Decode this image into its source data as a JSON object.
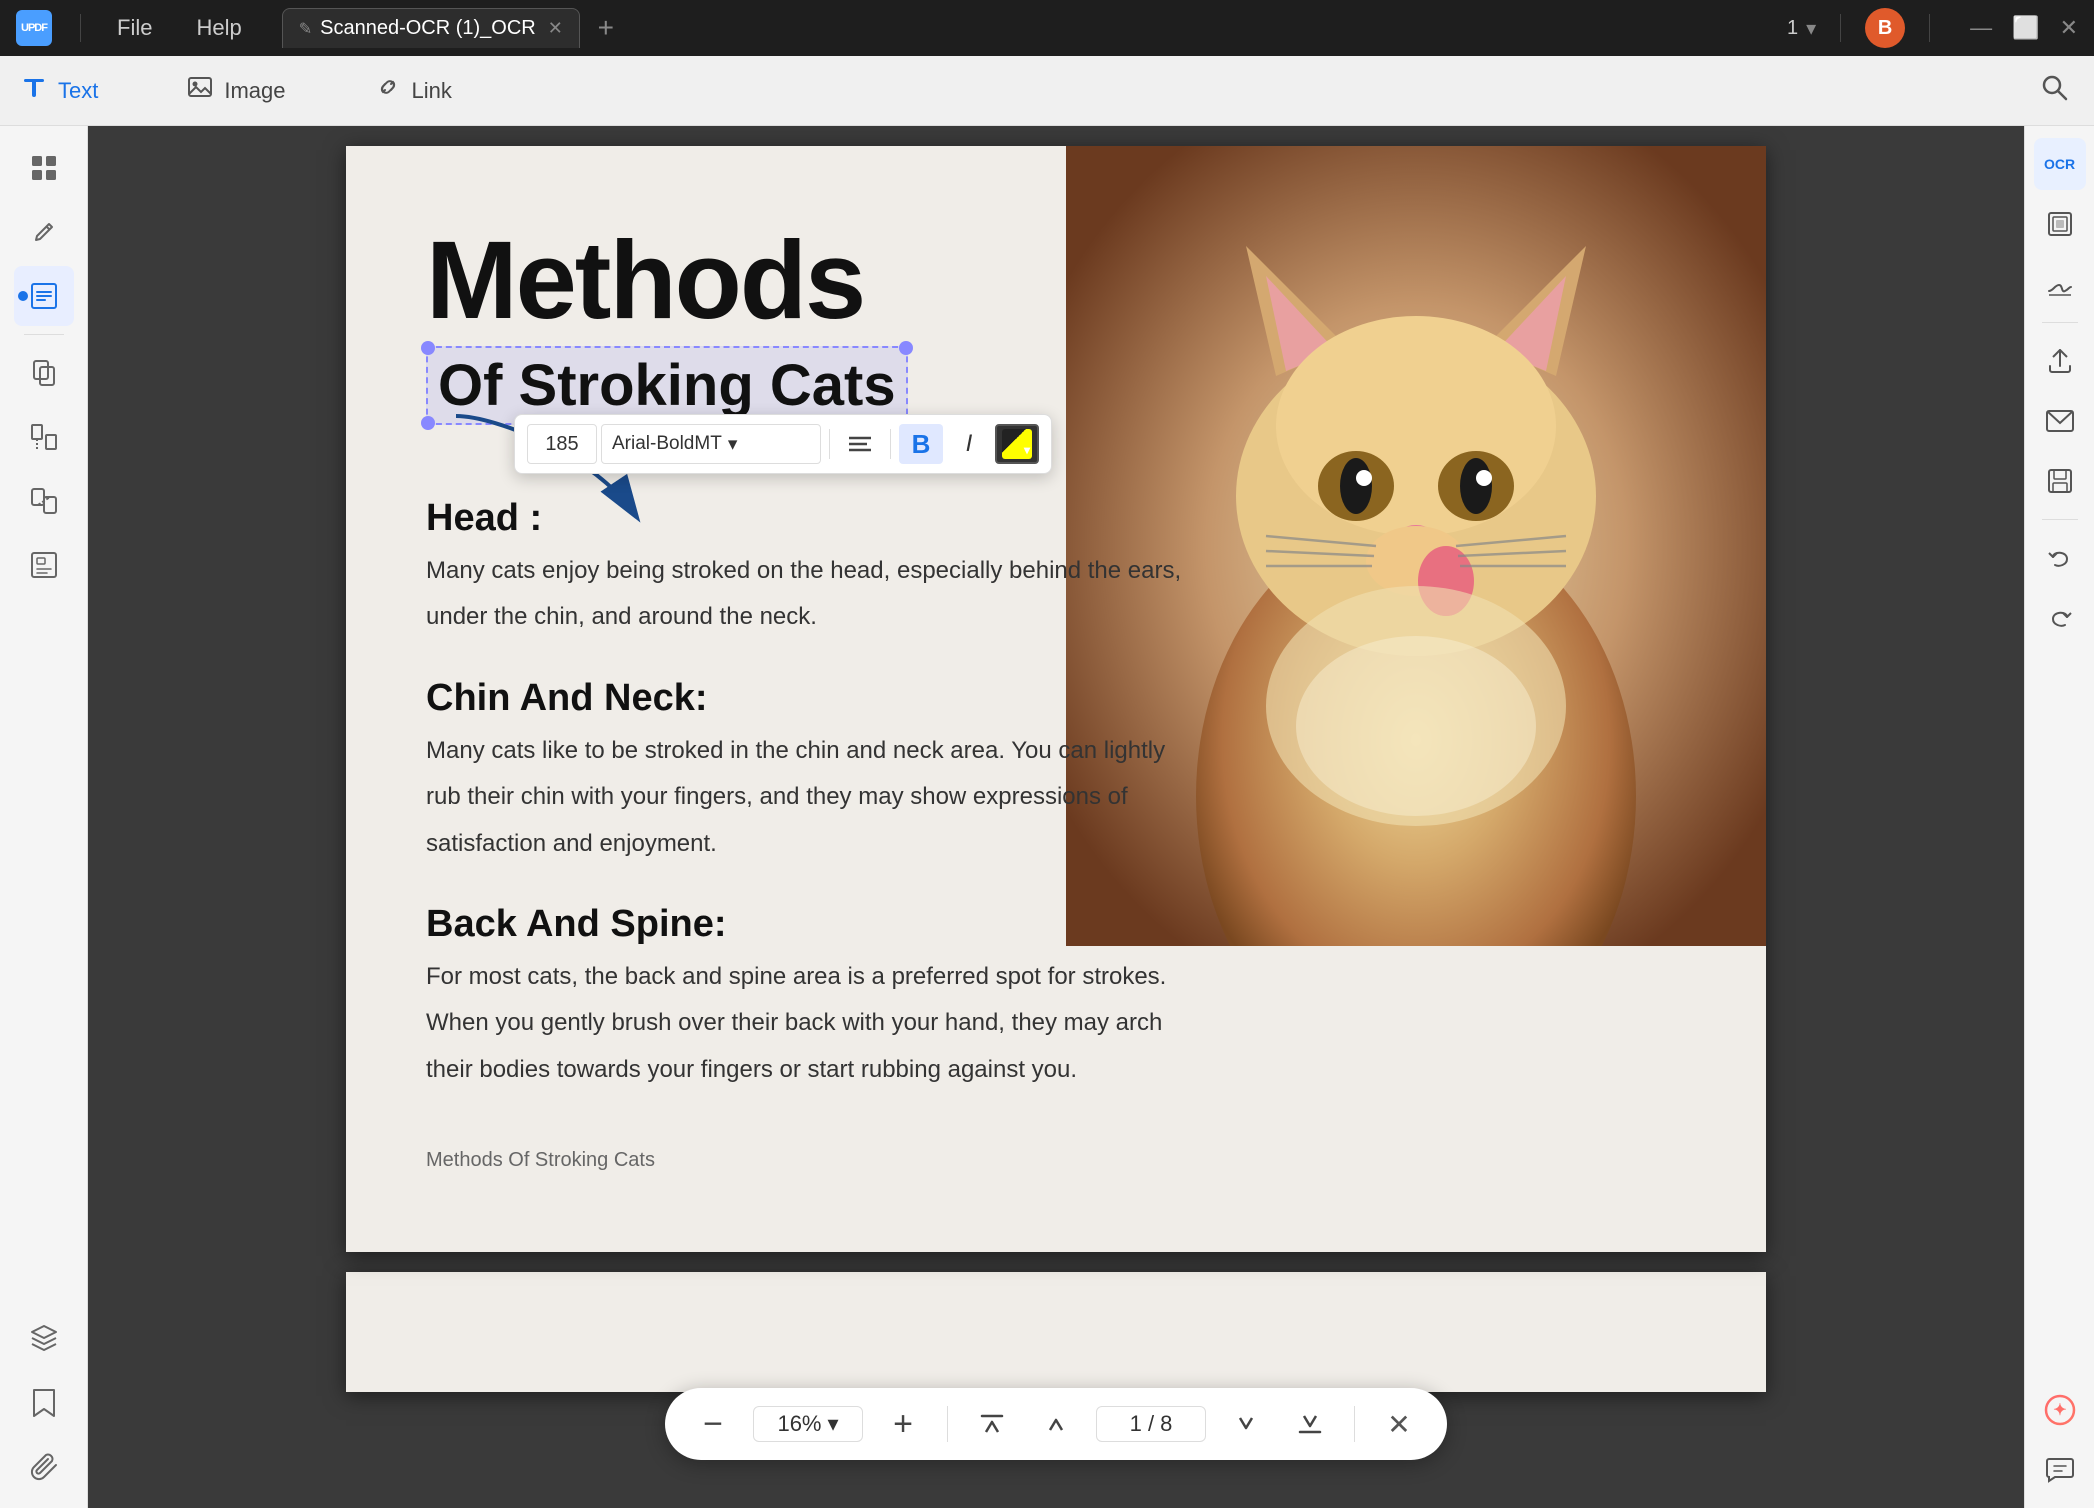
{
  "app": {
    "logo_text": "UPDF",
    "logo_short": "U"
  },
  "titlebar": {
    "menu_file": "File",
    "menu_help": "Help",
    "tab_name": "Scanned-OCR (1)_OCR",
    "tab_icon": "✎",
    "add_tab": "+",
    "page_current": "1",
    "page_total": "8",
    "page_separator": "/",
    "user_initial": "B",
    "win_minimize": "—",
    "win_maximize": "⬜",
    "win_close": "✕"
  },
  "toolbar": {
    "text_label": "Text",
    "image_label": "Image",
    "link_label": "Link",
    "search_icon": "🔍"
  },
  "left_sidebar": {
    "icons": [
      {
        "name": "thumbnails",
        "symbol": "⊞",
        "active": false
      },
      {
        "name": "edit",
        "symbol": "✏",
        "active": false
      },
      {
        "name": "annotate",
        "symbol": "📝",
        "active": true,
        "has_dot": true
      },
      {
        "name": "pages",
        "symbol": "⊡",
        "active": false
      },
      {
        "name": "organize",
        "symbol": "⧉",
        "active": false
      },
      {
        "name": "convert",
        "symbol": "⟳",
        "active": false
      },
      {
        "name": "forms",
        "symbol": "☐",
        "active": false
      }
    ],
    "bottom_icons": [
      {
        "name": "layers",
        "symbol": "⊕"
      },
      {
        "name": "bookmark",
        "symbol": "🔖"
      },
      {
        "name": "attachment",
        "symbol": "📎"
      }
    ]
  },
  "text_toolbar": {
    "font_size": "185",
    "font_family": "Arial-BoldMT",
    "align_icon": "≡",
    "bold_label": "B",
    "italic_label": "I",
    "color_icon": "▼"
  },
  "pdf": {
    "header_text": "Methods",
    "subtitle": "Of Stroking Cats",
    "section1_title": "Head :",
    "section1_text1": "Many cats enjoy being stroked on the head, especially behind the ears,",
    "section1_text2": "under the chin, and around the neck.",
    "section2_title": "Chin And Neck:",
    "section2_text1": "Many cats like to be stroked in the chin and neck area. You can lightly",
    "section2_text2": "rub their chin with your fingers, and they may show expressions of",
    "section2_text3": "satisfaction and enjoyment.",
    "section3_title": "Back And Spine:",
    "section3_text1": "For most cats, the back and spine area is a preferred spot for strokes.",
    "section3_text2": "When you gently brush over their back with your hand, they may arch",
    "section3_text3": "their bodies towards your fingers or start rubbing against you.",
    "footer": "Methods Of Stroking Cats"
  },
  "right_sidebar": {
    "icons": [
      {
        "name": "ocr",
        "symbol": "OCR"
      },
      {
        "name": "scan",
        "symbol": "⊡"
      },
      {
        "name": "pdf-sign",
        "symbol": "✍"
      },
      {
        "name": "upload",
        "symbol": "↑"
      },
      {
        "name": "mail",
        "symbol": "✉"
      },
      {
        "name": "save",
        "symbol": "💾"
      },
      {
        "name": "undo",
        "symbol": "↩"
      },
      {
        "name": "redo",
        "symbol": "↪"
      },
      {
        "name": "ai",
        "symbol": "✦"
      }
    ]
  },
  "bottom_toolbar": {
    "zoom_out": "−",
    "zoom_level": "16%",
    "zoom_dropdown": "▾",
    "zoom_in": "+",
    "page_first": "⟨⟨",
    "page_prev": "⟨",
    "page_next": "⟩",
    "page_last": "⟩⟩",
    "page_info": "1 / 8",
    "close": "✕"
  }
}
